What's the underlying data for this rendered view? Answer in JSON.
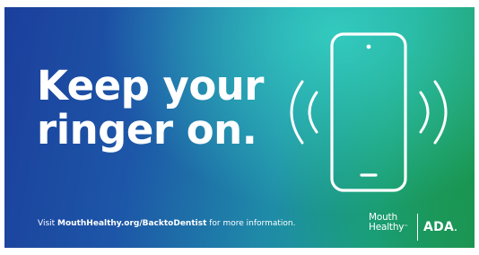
{
  "headline": {
    "line1": "Keep your",
    "line2": "ringer on."
  },
  "illustration": {
    "icon": "ringing-phone-icon",
    "color": "#ffffff"
  },
  "footer": {
    "prefix": "Visit ",
    "url": "MouthHealthy.org/BacktoDentist",
    "suffix": " for more information."
  },
  "logos": {
    "mouth_healthy_line1": "Mouth",
    "mouth_healthy_line2": "Healthy",
    "trademark": "™",
    "ada": "ADA",
    "ada_mark": "."
  },
  "colors": {
    "gradient_left": "#1b3f9c",
    "gradient_mid": "#1f8aa8",
    "gradient_right": "#1d9350",
    "text": "#ffffff"
  }
}
